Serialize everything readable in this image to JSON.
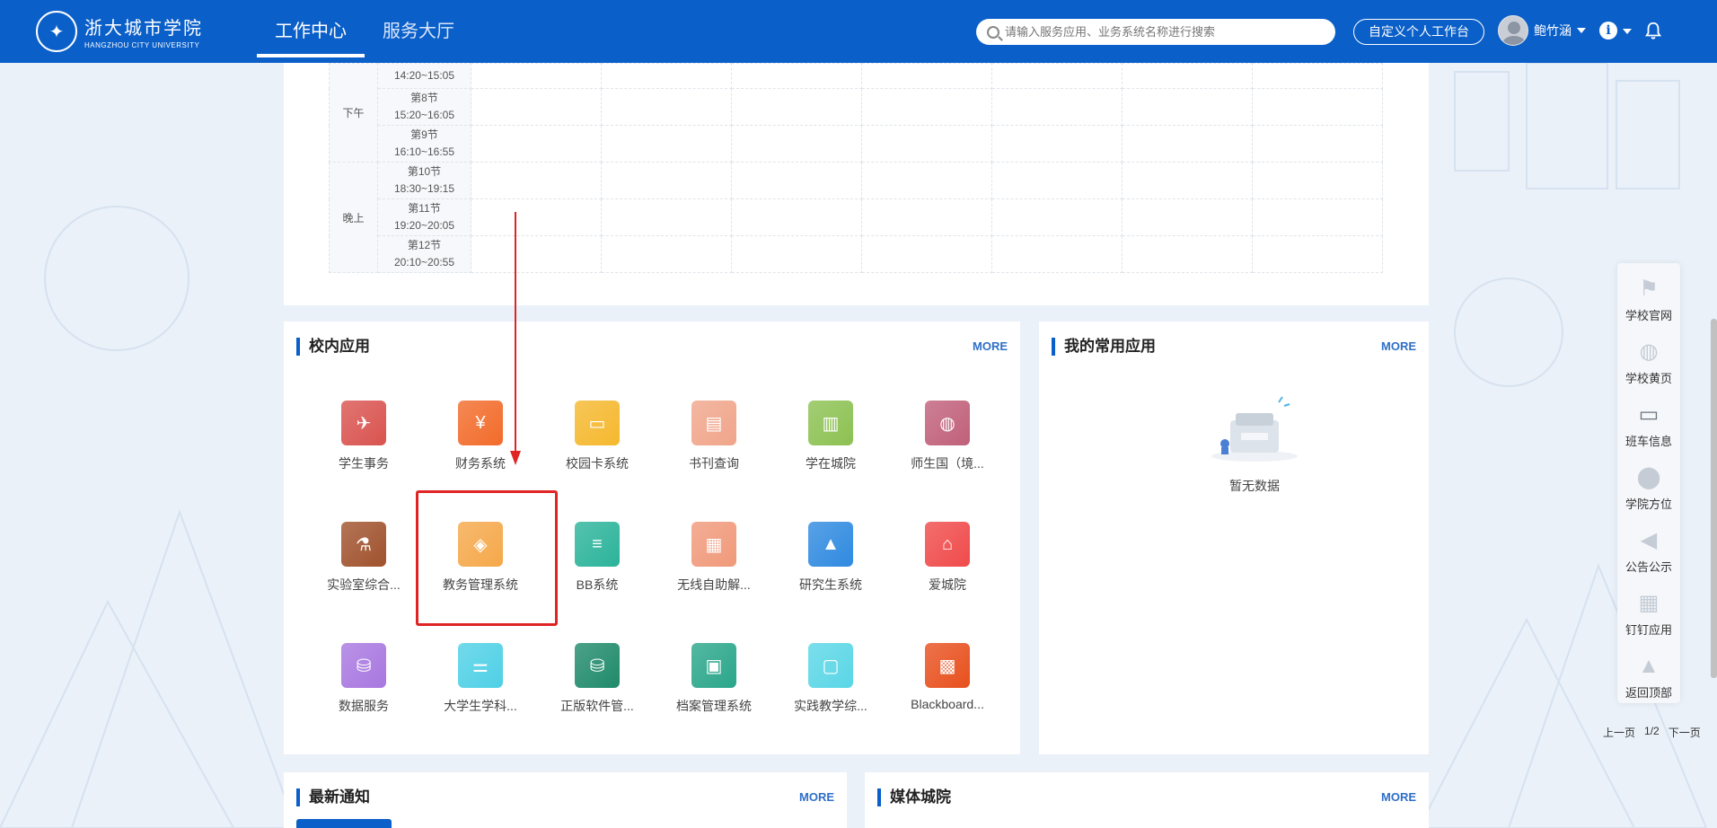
{
  "header": {
    "logo_cn": "浙大城市学院",
    "logo_en": "HANGZHOU CITY UNIVERSITY",
    "tabs": [
      {
        "label": "工作中心"
      },
      {
        "label": "服务大厅"
      }
    ],
    "search_placeholder": "请输入服务应用、业务系统名称进行搜索",
    "custom_button": "自定义个人工作台",
    "user_name": "鲍竹涵"
  },
  "timetable": {
    "periods": [
      {
        "label": "下午"
      },
      {
        "label": "晚上"
      }
    ],
    "slots": [
      {
        "name": "",
        "time": "14:20~15:05"
      },
      {
        "name": "第8节",
        "time": "15:20~16:05"
      },
      {
        "name": "第9节",
        "time": "16:10~16:55"
      },
      {
        "name": "第10节",
        "time": "18:30~19:15"
      },
      {
        "name": "第11节",
        "time": "19:20~20:05"
      },
      {
        "name": "第12节",
        "time": "20:10~20:55"
      }
    ]
  },
  "campus_apps": {
    "title": "校内应用",
    "more": "MORE",
    "apps": [
      {
        "label": "学生事务",
        "color": "#d9534f",
        "icon": "plane-icon"
      },
      {
        "label": "财务系统",
        "color": "#f26b2a",
        "icon": "finance-icon"
      },
      {
        "label": "校园卡系统",
        "color": "#f5b82e",
        "icon": "card-icon"
      },
      {
        "label": "书刊查询",
        "color": "#f0a58a",
        "icon": "book-icon"
      },
      {
        "label": "学在城院",
        "color": "#8cc152",
        "icon": "study-icon"
      },
      {
        "label": "师生国（境...",
        "color": "#c0607a",
        "icon": "globe-icon"
      },
      {
        "label": "实验室综合...",
        "color": "#a0522d",
        "icon": "lab-icon"
      },
      {
        "label": "教务管理系统",
        "color": "#f5a84a",
        "icon": "cube-icon"
      },
      {
        "label": "BB系统",
        "color": "#2bb39a",
        "icon": "list-icon"
      },
      {
        "label": "无线自助解...",
        "color": "#f0997a",
        "icon": "document-icon"
      },
      {
        "label": "研究生系统",
        "color": "#2f8ae0",
        "icon": "graduation-cap-icon"
      },
      {
        "label": "爱城院",
        "color": "#f04a4a",
        "icon": "home-heart-icon"
      },
      {
        "label": "数据服务",
        "color": "#a877e0",
        "icon": "database-gear-icon"
      },
      {
        "label": "大学生学科...",
        "color": "#4fd0e6",
        "icon": "sliders-icon"
      },
      {
        "label": "正版软件管...",
        "color": "#1f8a6a",
        "icon": "database-gear-icon"
      },
      {
        "label": "档案管理系统",
        "color": "#2aa68a",
        "icon": "clipboard-icon"
      },
      {
        "label": "实践教学综...",
        "color": "#5ad6e6",
        "icon": "folder-icon"
      },
      {
        "label": "Blackboard...",
        "color": "#e8501e",
        "icon": "monitor-icon"
      }
    ]
  },
  "common_apps": {
    "title": "我的常用应用",
    "more": "MORE",
    "empty_text": "暂无数据"
  },
  "notices": {
    "title": "最新通知",
    "more": "MORE"
  },
  "media": {
    "title": "媒体城院",
    "more": "MORE"
  },
  "float_menu": [
    {
      "label": "学校官网",
      "icon": "signpost-icon"
    },
    {
      "label": "学校黄页",
      "icon": "globe-icon"
    },
    {
      "label": "班车信息",
      "icon": "bus-icon"
    },
    {
      "label": "学院方位",
      "icon": "map-pin-icon"
    },
    {
      "label": "公告公示",
      "icon": "megaphone-icon"
    },
    {
      "label": "钉钉应用",
      "icon": "apps-grid-icon"
    },
    {
      "label": "返回顶部",
      "icon": "rocket-icon"
    }
  ],
  "pager": {
    "prev": "上一页",
    "page": "1/2",
    "next": "下一页"
  }
}
